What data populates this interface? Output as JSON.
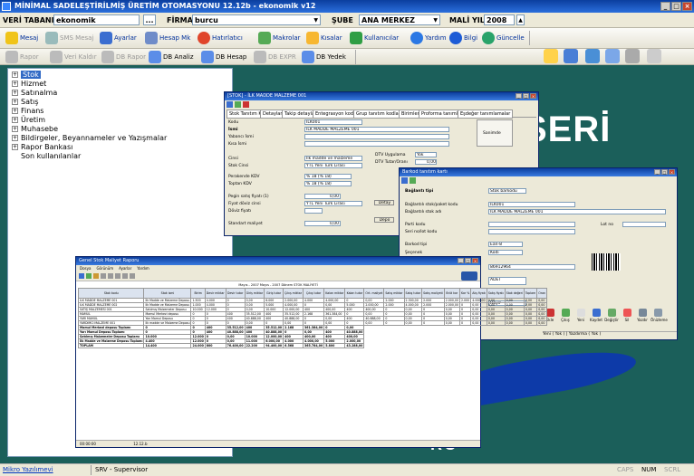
{
  "app": {
    "title": "MİNİMAL SADELEŞTİRİLMİŞ ÜRETİM OTOMASYONU 12.12b - ekonomik v12"
  },
  "toolbar1": {
    "db_label": "VERİ TABANI",
    "db_value": "ekonomik",
    "db_btn": "...",
    "company_label": "FİRMA",
    "company_value": "burcu",
    "branch_label": "ŞUBE",
    "branch_value": "ANA MERKEZ",
    "year_label": "MALİ YIL",
    "year_value": "2008"
  },
  "toolbar2": {
    "items": [
      "Mesaj",
      "SMS Mesaj",
      "Ayarlar",
      "Hesap Mk",
      "Hatırlatıcı",
      "Makrolar",
      "Kısalar",
      "Kullanıcılar",
      "Yardım",
      "Bilgi",
      "Güncelle"
    ]
  },
  "toolbar3": {
    "items": [
      "Rapor",
      "Veri Kaldır",
      "DB Rapor",
      "DB Analiz",
      "DB Hesap",
      "DB EXPR",
      "DB Yedek"
    ]
  },
  "tree": {
    "items": [
      "Stok",
      "Hizmet",
      "Satınalma",
      "Satış",
      "Finans",
      "Üretim",
      "Muhasebe",
      "Bildirgeler, Beyannameler ve Yazışmalar",
      "Rapor Bankası",
      "Son kullanılanlar"
    ]
  },
  "bg": {
    "logo_top": "SERİ",
    "logo_mid": "XX",
    "logo_bottom": "RO"
  },
  "stok_win": {
    "title": "[STOK] - İLK MADDE MALZEME 001",
    "tabs": [
      "Stok Tanıtım Kartı",
      "Detaylar",
      "Takip detayları",
      "Entegrasyon kodları",
      "Grup tanıtım kodları",
      "Birimler",
      "Proforma tanımlar",
      "Eşdeğer tanımlamalar"
    ],
    "labels": [
      "Kodu",
      "İsmi",
      "Yabancı İsmi",
      "Kısa İsmi",
      "Cinsi",
      "Stok Cinsi",
      "Perakende KDV",
      "Toptan KDV",
      "Pegin satış fiyatı (1)",
      "Fiyat döviz cinsi",
      "Döviz fiyatı",
      "Standart maliyet"
    ],
    "values": [
      "ILK001",
      "İLK MADDE MALZEME 001",
      "",
      "",
      "İlk madde ve malzeme",
      "YTL Yeni Türk Lirası",
      "% 18 (% 18)",
      "% 18 (% 18)",
      "0,00",
      "YTL Yeni Türk Lirası",
      "",
      "0,00"
    ],
    "right_labels": [
      "DTV Uygulama",
      "DTV Tutar/Oranı"
    ],
    "right_values": [
      "Yok",
      "0,00"
    ],
    "side_btns": [
      "Sanimde",
      "Detay",
      "Depo"
    ]
  },
  "barkod_win": {
    "title": "Barkod tanıtım kartı",
    "labels": [
      "Bağlantı tipi",
      "Bağlantılı stok/paket kodu",
      "Bağlantılı stok adı",
      "Parti kodu",
      "Seri no/lot kodu",
      "Barkod tipi",
      "Şeçenek"
    ],
    "values": [
      "Stok barkodu",
      "ILK001",
      "İLK MADDE MALZEME 001",
      "",
      "",
      "Ean-8",
      "Kodi",
      "86912964",
      "ADET",
      "Hayır"
    ],
    "lot_label": "Lot no",
    "buttons": [
      "Ekle",
      "Çıkış",
      "Yeni",
      "Kaydet",
      "Değiştir",
      "Sil",
      "Yazdır",
      "Önizleme"
    ],
    "status": "Yeni ( Yok ) | Yazdırma ( Yok )"
  },
  "report_win": {
    "title": "Genel Stok Maliyet Raporu",
    "menu": [
      "Dosya",
      "Görünüm",
      "Ayarlar",
      "Yardım"
    ],
    "header_line": "Mayıs - 2007 Mayıs - 2007 Dönem STOK MALİYETİ",
    "columns": [
      "Stok kodu",
      "Stok ismi",
      "Birim",
      "Devir miktar",
      "Devir tutar",
      "Giriş miktar",
      "Giriş tutar",
      "Çıkış miktar",
      "Çıkış tutar",
      "Kalan miktar",
      "Kalan tutar",
      "Ort. maliyet",
      "Satış miktar",
      "Satış tutar",
      "Satış maliyeti",
      "Brüt kar",
      "Kar %",
      "Alış fiyatı",
      "Satış fiyatı",
      "Stok değeri",
      "Toplam",
      "Oran"
    ],
    "rows": [
      [
        "ILK MADDE MALZEME 001",
        "İlk Madde ve Malzeme Deposu",
        "1.500",
        "4.000",
        "0",
        "0,00",
        "6.000",
        "2.000,00",
        "4.000",
        "4.000,00",
        "0",
        "0,00",
        "2.000",
        "2.300,00",
        "2.000",
        "2.000,00",
        "2.000",
        "4.000,00",
        "0,00",
        "0,00",
        "0,00",
        "0,00"
      ],
      [
        "ILK MADDE MALZEME 002",
        "İlk Madde ve Malzeme Deposu",
        "1.000",
        "4.000",
        "0",
        "0,00",
        "5.000",
        "4.000,00",
        "0",
        "0,00",
        "5.000",
        "2.000,00",
        "2.000",
        "4.000,00",
        "2.000",
        "2.000,00",
        "0",
        "0,00",
        "0,00",
        "0,00",
        "0,00",
        "0,00"
      ],
      [
        "SATIŞ MALZEMESİ 001",
        "Satılmış Malzemeler Deposu",
        "10.000",
        "12.000",
        "0",
        "0,00",
        "10.000",
        "12.000,00",
        "400",
        "400,00",
        "400",
        "400,00",
        "0",
        "0,00",
        "0",
        "0,00",
        "0",
        "0,00",
        "0,00",
        "0,00",
        "0,00",
        "0,00"
      ],
      [
        "MAMUL",
        "Mamul Merkezi deposu",
        "0",
        "0",
        "400",
        "35.512,00",
        "400",
        "35.512,00",
        "2.168",
        "361.384,00",
        "0",
        "0,00",
        "0",
        "0,00",
        "0",
        "0,00",
        "0",
        "0,00",
        "0,00",
        "0,00",
        "0,00",
        "0,00"
      ],
      [
        "YARI MAMUL",
        "Yarı Mamul Deposu",
        "0",
        "0",
        "400",
        "40.888,00",
        "400",
        "40.888,00",
        "0",
        "0,00",
        "400",
        "40.888,00",
        "0",
        "0,00",
        "0",
        "0,00",
        "0",
        "0,00",
        "0,00",
        "0,00",
        "0,00",
        "0,00"
      ],
      [
        "YARDIMCI MALZEME 001",
        "İlk madde ve Malzeme Deposu",
        "0",
        "0",
        "0",
        "0,00",
        "0",
        "0,00",
        "0",
        "0,00",
        "0",
        "0,00",
        "0",
        "0,00",
        "0",
        "0,00",
        "0",
        "0,00",
        "0,00",
        "0,00",
        "0,00",
        "0,00"
      ]
    ],
    "totals": [
      [
        "Mamul Merkezi deposu Toplamı",
        "0",
        "0",
        "400",
        "35.512,00",
        "400",
        "35.512,00",
        "2.168",
        "361.384,00",
        "0",
        "0,00"
      ],
      [
        "Yarı Mamul Deposu Toplamı",
        "0",
        "0",
        "400",
        "40.888,00",
        "400",
        "40.888,00",
        "0",
        "0,00",
        "400",
        "40.888,00"
      ],
      [
        "Satılmış Malzemeler Deposu Toplamı",
        "10.000",
        "12.000",
        "0",
        "0,00",
        "10.000",
        "12.000,00",
        "400",
        "400,00",
        "400",
        "400,00"
      ],
      [
        "İlk Madde ve Malzeme Deposu Toplamı",
        "4.400",
        "12.000",
        "0",
        "0,00",
        "11.000",
        "6.000,00",
        "4.000",
        "4.000,00",
        "5.000",
        "2.000,00"
      ],
      [
        "TOPLAM",
        "14.400",
        "24.000",
        "800",
        "76.400,00",
        "22.200",
        "94.400,00",
        "6.568",
        "365.784,00",
        "5.800",
        "43.288,00"
      ]
    ],
    "status_left": "00:00:00",
    "status_mid": "12.12.b"
  },
  "status": {
    "user_link": "Mikro Yazılımevi",
    "user": "SRV - Supervisor",
    "keys": [
      "CAPS",
      "NUM",
      "SCRL"
    ]
  }
}
